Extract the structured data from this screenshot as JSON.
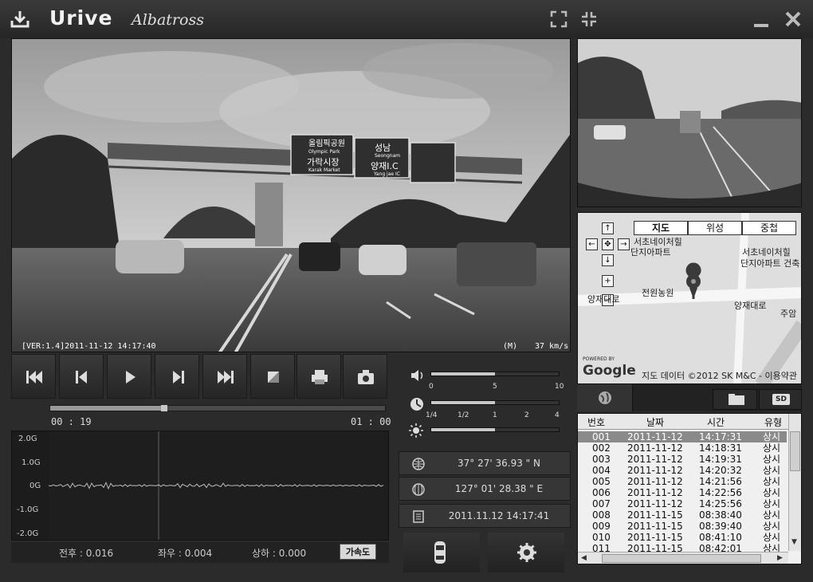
{
  "app": {
    "brand": "Urive",
    "brand_sub": "Albatross"
  },
  "icons": {
    "download": "download-icon",
    "fullscreen": "fullscreen-icon",
    "minimize": "minimize-icon",
    "close": "close-icon"
  },
  "video": {
    "version_stamp": "[VER:1.4]2011-11-12  14:17:40",
    "mode": "(M)",
    "speed": "37 km/s",
    "sign_texts": [
      "올림픽공원",
      "Olympic Park",
      "가락시장",
      "Karak Market",
      "성남",
      "Seongnam",
      "양재I.C",
      "Yang jae IC"
    ]
  },
  "controls": [
    "skip-to-start",
    "previous-frame",
    "play",
    "next-frame",
    "skip-to-end",
    "stop",
    "print",
    "snapshot"
  ],
  "playback": {
    "current_time": "00 : 19",
    "total_time": "01 : 00",
    "progress": 0.33
  },
  "volume": {
    "level": 0.5,
    "ticks": [
      "0",
      "5",
      "10"
    ]
  },
  "speed_slider": {
    "level": 0.5,
    "ticks": [
      "1/4",
      "1/2",
      "1",
      "2",
      "4"
    ]
  },
  "brightness": {
    "level": 0.5
  },
  "gsensor": {
    "y_labels": [
      "2.0G",
      "1.0G",
      "0G",
      "-1.0G",
      "-2.0G"
    ],
    "front_back_label": "전후 : 0.016",
    "left_right_label": "좌우 : 0.004",
    "up_down_label": "상하 : 0.000",
    "accel_button": "가속도"
  },
  "gps": {
    "latitude": "37° 27'  36.93 \"  N",
    "longitude": "127° 01'  28.38 \"  E",
    "datetime": "2011.11.12  14:17:41"
  },
  "map": {
    "tabs": [
      "지도",
      "위성",
      "중첩"
    ],
    "labels": {
      "top_cut": "서초네이처힐",
      "left_label1": "서초네이처힐",
      "left_label2": "단지아파트",
      "right_label1": "서초네이처힐",
      "right_label2": "단지아파트 건축",
      "jeonwon": "전원농원",
      "road_left": "양재대로",
      "road_right": "양재대로",
      "juam": "주암",
      "powered": "POWERED BY",
      "google": "Google",
      "attribution": "지도 데이터 ©2012 SK M&C - 이용약관"
    }
  },
  "log": {
    "headers": [
      "번호",
      "날짜",
      "시간",
      "유형"
    ],
    "rows": [
      [
        "001",
        "2011-11-12",
        "14:17:31",
        "상시"
      ],
      [
        "002",
        "2011-11-12",
        "14:18:31",
        "상시"
      ],
      [
        "003",
        "2011-11-12",
        "14:19:31",
        "상시"
      ],
      [
        "004",
        "2011-11-12",
        "14:20:32",
        "상시"
      ],
      [
        "005",
        "2011-11-12",
        "14:21:56",
        "상시"
      ],
      [
        "006",
        "2011-11-12",
        "14:22:56",
        "상시"
      ],
      [
        "007",
        "2011-11-12",
        "14:25:56",
        "상시"
      ],
      [
        "008",
        "2011-11-15",
        "08:38:40",
        "상시"
      ],
      [
        "009",
        "2011-11-15",
        "08:39:40",
        "상시"
      ],
      [
        "010",
        "2011-11-15",
        "08:41:10",
        "상시"
      ],
      [
        "011",
        "2011-11-15",
        "08:42:01",
        "상시"
      ]
    ]
  },
  "tabs_right": {
    "sd_label": "SD"
  },
  "colors": {
    "background": "#2b2b2b",
    "selected_row": "#8a8a8a",
    "map_pin": "#3a3a3a"
  }
}
